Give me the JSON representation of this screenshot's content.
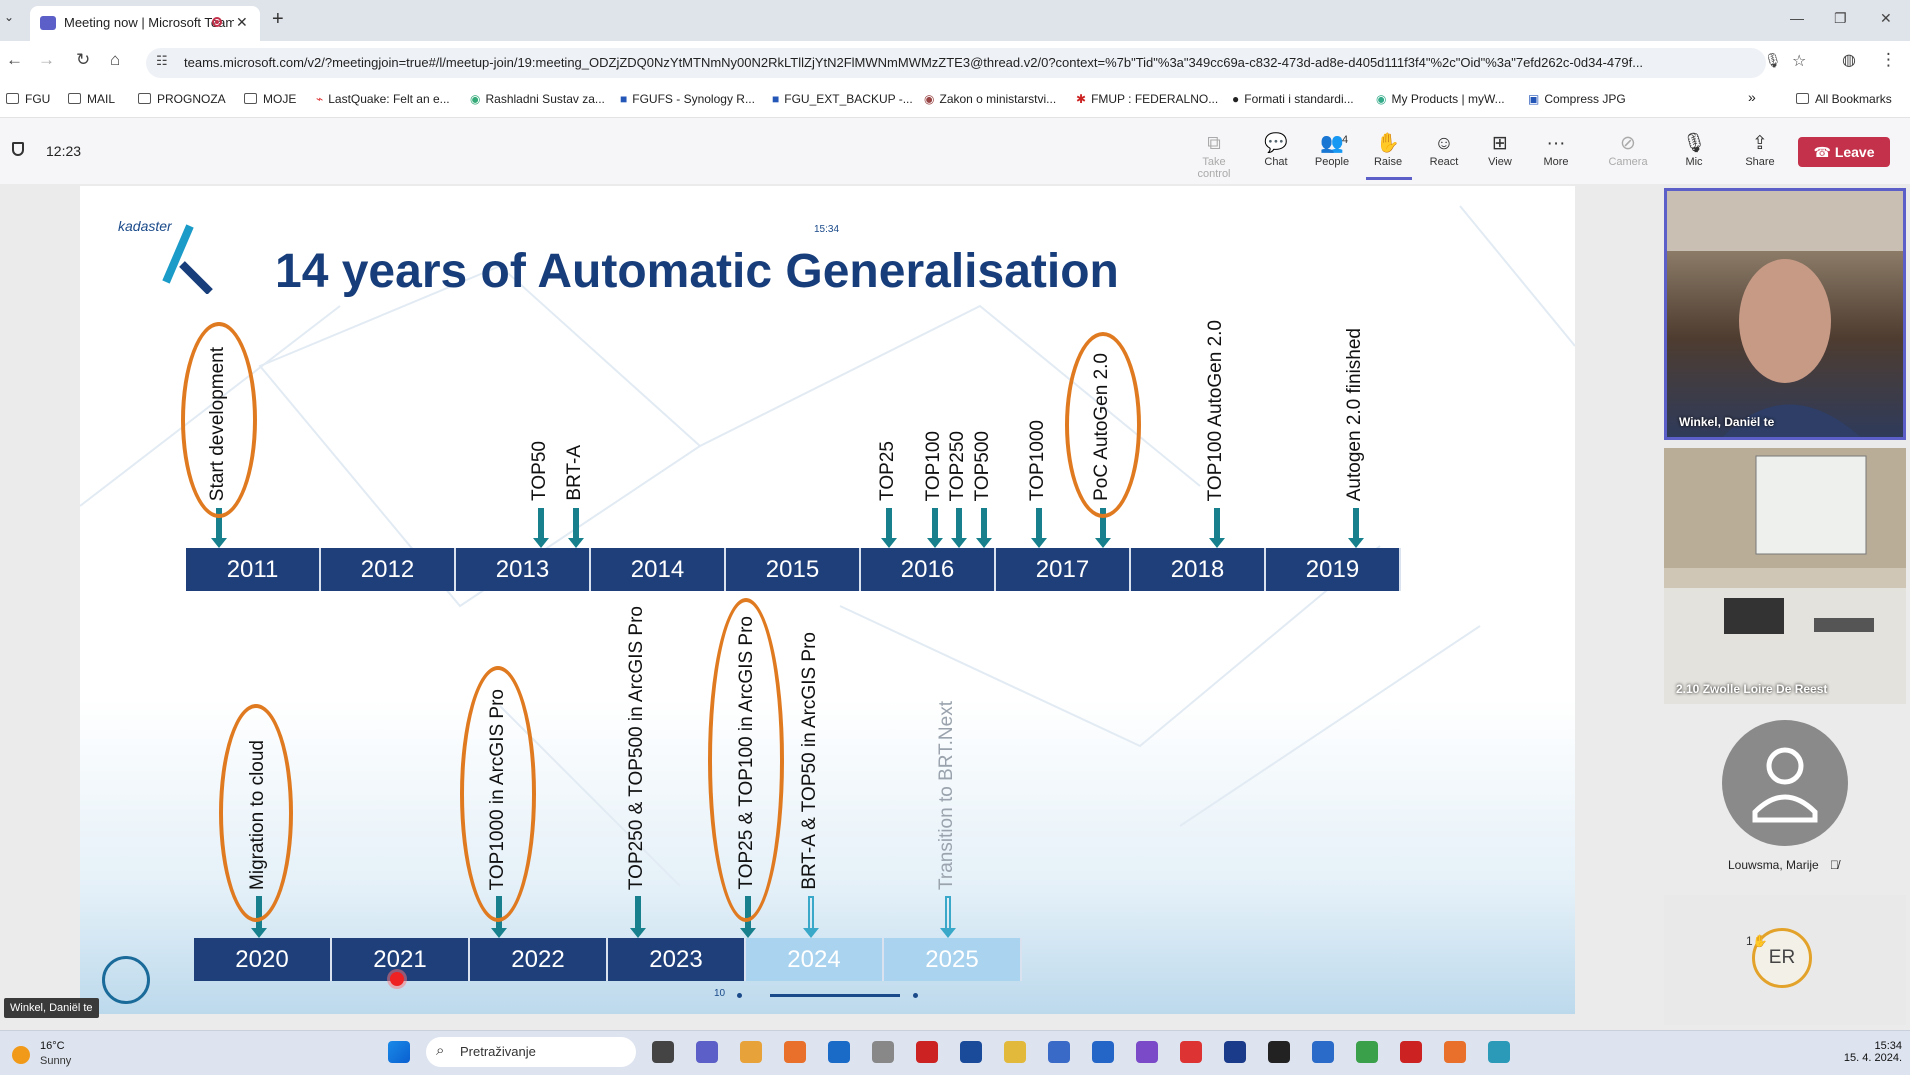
{
  "browser": {
    "tab_title": "Meeting now | Microsoft Teams",
    "new_tab": "+",
    "url": "teams.microsoft.com/v2/?meetingjoin=true#/l/meetup-join/19:meeting_ODZjZDQ0NzYtMTNmNy00N2RkLTllZjYtN2FlMWNmMWMzZTE3@thread.v2/0?context=%7b\"Tid\"%3a\"349cc69a-c832-473d-ad8e-d405d111f3f4\"%2c\"Oid\"%3a\"7efd262c-0d34-479f...",
    "bookmarks": [
      "FGU",
      "MAIL",
      "PROGNOZA",
      "MOJE",
      "LastQuake: Felt an e...",
      "Rashladni Sustav za...",
      "FGUFS - Synology R...",
      "FGU_EXT_BACKUP -...",
      "Zakon o ministarstvi...",
      "FMUP : FEDERALNO...",
      "Formati i standardi...",
      "My Products | myW...",
      "Compress JPG"
    ],
    "all_bookmarks": "All Bookmarks"
  },
  "meeting": {
    "timer": "12:23",
    "tools": [
      {
        "label": "Take control",
        "icon": "take-control-icon",
        "glyph": "⧉",
        "dim": true
      },
      {
        "label": "Chat",
        "icon": "chat-icon",
        "glyph": "💬",
        "dim": false
      },
      {
        "label": "People",
        "icon": "people-icon",
        "glyph": "👥",
        "badge": "4",
        "dim": false
      },
      {
        "label": "Raise",
        "icon": "raise-hand-icon",
        "glyph": "✋",
        "dim": false
      },
      {
        "label": "React",
        "icon": "react-icon",
        "glyph": "☺",
        "dim": false
      },
      {
        "label": "View",
        "icon": "view-icon",
        "glyph": "⊞",
        "dim": false
      },
      {
        "label": "More",
        "icon": "more-icon",
        "glyph": "···",
        "dim": false
      },
      {
        "label": "Camera",
        "icon": "camera-off-icon",
        "glyph": "⊘",
        "dim": true
      },
      {
        "label": "Mic",
        "icon": "mic-off-icon",
        "glyph": "🎙",
        "dim": false
      },
      {
        "label": "Share",
        "icon": "share-icon",
        "glyph": "⇪",
        "dim": false
      }
    ],
    "leave_label": "Leave",
    "accent": "#5b5fc7",
    "leave_color": "#c4314b"
  },
  "slide": {
    "logo_text": "kadaster",
    "time_mark": "15:34",
    "title": "14 years of Automatic Generalisation",
    "top_years": [
      "2011",
      "2012",
      "2013",
      "2014",
      "2015",
      "2016",
      "2017",
      "2018",
      "2019"
    ],
    "top_labels": [
      "Start development",
      "TOP50",
      "BRT-A",
      "TOP25",
      "TOP100",
      "TOP250",
      "TOP500",
      "TOP1000",
      "PoC AutoGen 2.0",
      "TOP100 AutoGen 2.0",
      "Autogen 2.0 finished"
    ],
    "bottom_years": [
      "2020",
      "2021",
      "2022",
      "2023",
      "2024",
      "2025"
    ],
    "bottom_labels": [
      "Migration to cloud",
      "TOP1000 in ArcGIS Pro",
      "TOP250 & TOP500 in ArcGIS Pro",
      "TOP25 & TOP100 in ArcGIS Pro",
      "BRT-A & TOP50 in ArcGIS Pro",
      "Transition to BRT.Next"
    ],
    "page_number": "10",
    "highlight_color": "#e07a20",
    "bar_color": "#1f3f7a"
  },
  "participants": {
    "presenter_chip": "Winkel, Daniël te",
    "tiles": [
      {
        "name": "Winkel, Daniël te"
      },
      {
        "name": "2.10 Zwolle Loire De Reest"
      }
    ],
    "avatar_name": "Louwsma, Marije",
    "initials": "ER",
    "raised_count": "1"
  },
  "taskbar": {
    "temp": "16°C",
    "condition": "Sunny",
    "search_placeholder": "Pretraživanje",
    "time": "15:34",
    "date": "15. 4. 2024."
  }
}
